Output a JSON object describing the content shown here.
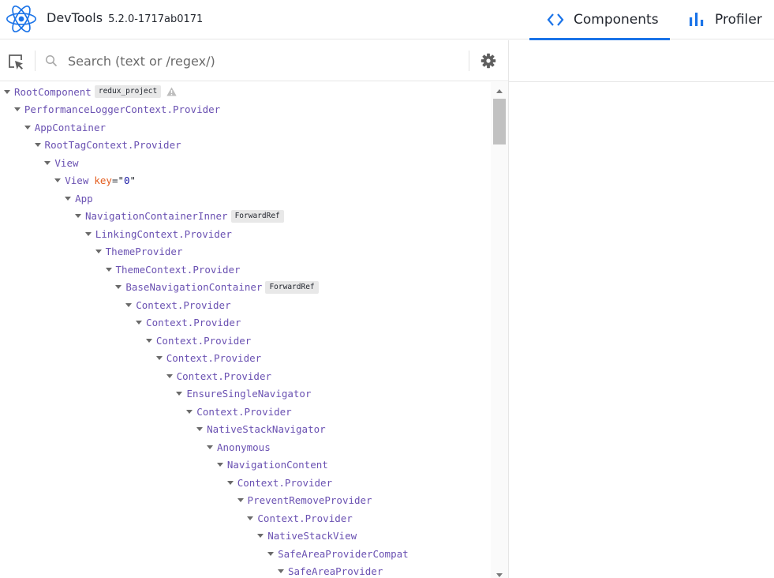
{
  "header": {
    "title": "DevTools",
    "version": "5.2.0-1717ab0171",
    "tabs": [
      {
        "label": "Components",
        "icon": "code-brackets-icon",
        "active": true
      },
      {
        "label": "Profiler",
        "icon": "bar-chart-icon",
        "active": false
      }
    ]
  },
  "toolbar": {
    "search_placeholder": "Search (text or /regex/)",
    "search_value": ""
  },
  "colors": {
    "accent": "#1a73e8",
    "component": "#6a51b2",
    "prop_key": "#e35d1e",
    "prop_value": "#1a1aa6",
    "logo": "#1a73e8"
  },
  "tree": [
    {
      "name": "RootComponent",
      "depth": 0,
      "badge": "redux_project",
      "warning": true
    },
    {
      "name": "PerformanceLoggerContext.Provider",
      "depth": 1
    },
    {
      "name": "AppContainer",
      "depth": 2
    },
    {
      "name": "RootTagContext.Provider",
      "depth": 3
    },
    {
      "name": "View",
      "depth": 4
    },
    {
      "name": "View",
      "depth": 5,
      "key": "0"
    },
    {
      "name": "App",
      "depth": 6
    },
    {
      "name": "NavigationContainerInner",
      "depth": 7,
      "badge": "ForwardRef"
    },
    {
      "name": "LinkingContext.Provider",
      "depth": 8
    },
    {
      "name": "ThemeProvider",
      "depth": 9
    },
    {
      "name": "ThemeContext.Provider",
      "depth": 10
    },
    {
      "name": "BaseNavigationContainer",
      "depth": 11,
      "badge": "ForwardRef"
    },
    {
      "name": "Context.Provider",
      "depth": 12
    },
    {
      "name": "Context.Provider",
      "depth": 13
    },
    {
      "name": "Context.Provider",
      "depth": 14
    },
    {
      "name": "Context.Provider",
      "depth": 15
    },
    {
      "name": "Context.Provider",
      "depth": 16
    },
    {
      "name": "EnsureSingleNavigator",
      "depth": 17
    },
    {
      "name": "Context.Provider",
      "depth": 18
    },
    {
      "name": "NativeStackNavigator",
      "depth": 19
    },
    {
      "name": "Anonymous",
      "depth": 20
    },
    {
      "name": "NavigationContent",
      "depth": 21
    },
    {
      "name": "Context.Provider",
      "depth": 22
    },
    {
      "name": "PreventRemoveProvider",
      "depth": 23
    },
    {
      "name": "Context.Provider",
      "depth": 24
    },
    {
      "name": "NativeStackView",
      "depth": 25
    },
    {
      "name": "SafeAreaProviderCompat",
      "depth": 26
    },
    {
      "name": "SafeAreaProvider",
      "depth": 27
    }
  ]
}
